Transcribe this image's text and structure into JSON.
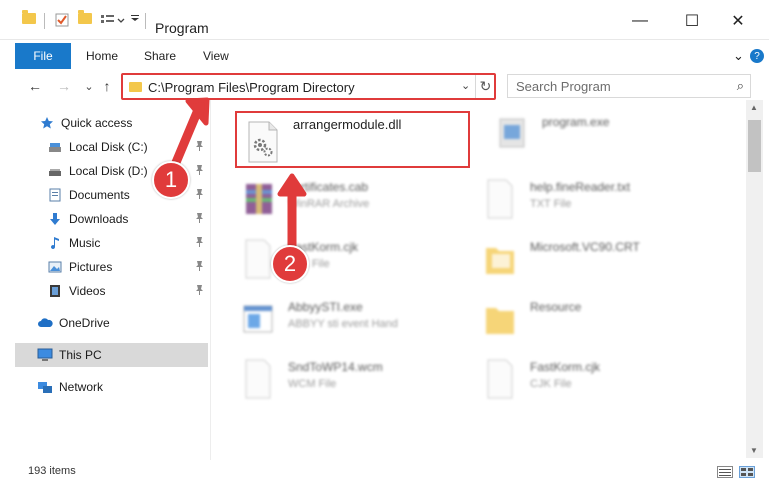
{
  "window": {
    "title": "Program",
    "minimize_glyph": "—",
    "maximize_glyph": "☐",
    "close_glyph": "✕"
  },
  "ribbon": {
    "tabs": [
      {
        "label": "File",
        "active": true
      },
      {
        "label": "Home"
      },
      {
        "label": "Share"
      },
      {
        "label": "View"
      }
    ],
    "expand_glyph": "⌄",
    "help_glyph": "?"
  },
  "address_bar": {
    "path": "C:\\Program Files\\Program Directory",
    "chevron_glyph": "⌄",
    "refresh_glyph": "↻"
  },
  "nav": {
    "back_glyph": "←",
    "forward_glyph": "→",
    "recent_glyph": "⌄",
    "up_glyph": "↑"
  },
  "search": {
    "placeholder": "Search Program",
    "icon_glyph": "⌕"
  },
  "sidebar": {
    "pin_glyph": "📌",
    "items": [
      {
        "label": "Quick access",
        "icon": "star-icon",
        "pinned": false
      },
      {
        "label": "Local Disk (C:)",
        "icon": "drive-icon",
        "pinned": true
      },
      {
        "label": "Local Disk (D:)",
        "icon": "drive-icon",
        "pinned": true
      },
      {
        "label": "Documents",
        "icon": "documents-icon",
        "pinned": true
      },
      {
        "label": "Downloads",
        "icon": "download-icon",
        "pinned": true
      },
      {
        "label": "Music",
        "icon": "music-icon",
        "pinned": true
      },
      {
        "label": "Pictures",
        "icon": "pictures-icon",
        "pinned": true
      },
      {
        "label": "Videos",
        "icon": "videos-icon",
        "pinned": true
      },
      {
        "label": "OneDrive",
        "icon": "cloud-icon",
        "pinned": false
      },
      {
        "label": "This PC",
        "icon": "computer-icon",
        "pinned": false,
        "selected": true
      },
      {
        "label": "Network",
        "icon": "network-icon",
        "pinned": false
      }
    ]
  },
  "files": [
    {
      "name": "arrangermodule.dll",
      "sub": "",
      "icon": "dll-file-icon",
      "highlighted": true
    },
    {
      "name": "program.exe",
      "sub": "",
      "icon": "exe-file-icon"
    },
    {
      "name": "certificates.cab",
      "sub": "WinRAR Archive",
      "icon": "archive-icon"
    },
    {
      "name": "help.fineReader.txt",
      "sub": "TXT File",
      "icon": "text-file-icon"
    },
    {
      "name": "FastKorm.cjk",
      "sub": "CJK File",
      "icon": "generic-file-icon"
    },
    {
      "name": "Microsoft.VC90.CRT",
      "sub": "",
      "icon": "folder-icon"
    },
    {
      "name": "AbbyySTI.exe",
      "sub": "ABBYY sti event Hand",
      "icon": "app-window-icon"
    },
    {
      "name": "Resource",
      "sub": "",
      "icon": "folder-icon"
    },
    {
      "name": "SndToWP14.wcm",
      "sub": "WCM File",
      "icon": "generic-file-icon"
    },
    {
      "name": "FastKorm.cjk",
      "sub": "CJK File",
      "icon": "generic-file-icon"
    }
  ],
  "status": {
    "items_count": "193 items"
  },
  "callouts": [
    {
      "number": "1"
    },
    {
      "number": "2"
    }
  ],
  "colors": {
    "accent": "#1979ca",
    "callout": "#e03b3b",
    "folder": "#f3c74b"
  }
}
